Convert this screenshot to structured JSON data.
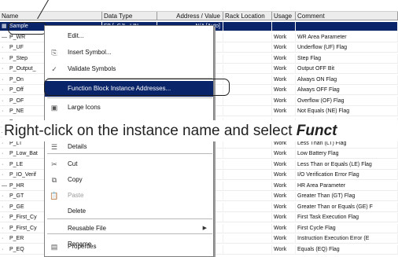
{
  "table": {
    "columns": [
      "Name",
      "Data Type",
      "Address / Value",
      "Rack Location",
      "Usage",
      "Comment"
    ],
    "rows": [
      {
        "marker": "▦",
        "name": "Sample",
        "type": "FB [_CJL_LIN",
        "addr": "N/A [Auto]",
        "rack": "",
        "usage": "",
        "comment": "",
        "selected": true
      },
      {
        "marker": "—",
        "name": "P_WR",
        "type": "",
        "addr": "",
        "rack": "",
        "usage": "Work",
        "comment": "WR Area Parameter"
      },
      {
        "marker": "·",
        "name": "P_UF",
        "type": "",
        "addr": "",
        "rack": "",
        "usage": "Work",
        "comment": "Underflow (UF) Flag"
      },
      {
        "marker": "·",
        "name": "P_Step",
        "type": "",
        "addr": "",
        "rack": "",
        "usage": "Work",
        "comment": "Step Flag"
      },
      {
        "marker": "·",
        "name": "P_Output_",
        "type": "",
        "addr": "",
        "rack": "",
        "usage": "Work",
        "comment": "Output OFF Bit"
      },
      {
        "marker": "·",
        "name": "P_On",
        "type": "",
        "addr": "",
        "rack": "",
        "usage": "Work",
        "comment": "Always ON Flag"
      },
      {
        "marker": "·",
        "name": "P_Off",
        "type": "",
        "addr": "",
        "rack": "",
        "usage": "Work",
        "comment": "Always OFF Flag"
      },
      {
        "marker": "·",
        "name": "P_OF",
        "type": "",
        "addr": "",
        "rack": "",
        "usage": "Work",
        "comment": "Overflow (OF) Flag"
      },
      {
        "marker": "·",
        "name": "P_NE",
        "type": "",
        "addr": "",
        "rack": "",
        "usage": "Work",
        "comment": "Not Equals (NE) Flag"
      },
      {
        "marker": "·",
        "name": "P_",
        "type": "",
        "addr": "",
        "rack": "",
        "usage": "",
        "comment": ""
      },
      {
        "marker": "—",
        "name": "F",
        "type": "",
        "addr": "",
        "rack": "",
        "usage": "",
        "comment": ""
      },
      {
        "marker": "·",
        "name": "P_LT",
        "type": "",
        "addr": "",
        "rack": "",
        "usage": "Work",
        "comment": "Less Than (LT) Flag"
      },
      {
        "marker": "·",
        "name": "P_Low_Bat",
        "type": "",
        "addr": "",
        "rack": "",
        "usage": "Work",
        "comment": "Low Battery Flag"
      },
      {
        "marker": "·",
        "name": "P_LE",
        "type": "",
        "addr": "",
        "rack": "",
        "usage": "Work",
        "comment": "Less Than or Equals (LE) Flag"
      },
      {
        "marker": "·",
        "name": "P_IO_Verif",
        "type": "",
        "addr": "",
        "rack": "",
        "usage": "Work",
        "comment": "I/O Verification Error Flag"
      },
      {
        "marker": "—",
        "name": "P_HR",
        "type": "",
        "addr": "",
        "rack": "",
        "usage": "Work",
        "comment": "HR Area Parameter"
      },
      {
        "marker": "·",
        "name": "P_GT",
        "type": "",
        "addr": "",
        "rack": "",
        "usage": "Work",
        "comment": "Greater Than (GT) Flag"
      },
      {
        "marker": "·",
        "name": "P_GE",
        "type": "",
        "addr": "",
        "rack": "",
        "usage": "Work",
        "comment": "Greater Than or Equals (GE) F"
      },
      {
        "marker": "·",
        "name": "P_First_Cy",
        "type": "",
        "addr": "",
        "rack": "",
        "usage": "Work",
        "comment": "First Task Execution Flag"
      },
      {
        "marker": "·",
        "name": "P_First_Cy",
        "type": "",
        "addr": "",
        "rack": "",
        "usage": "Work",
        "comment": "First Cycle Flag"
      },
      {
        "marker": "·",
        "name": "P_ER",
        "type": "",
        "addr": "",
        "rack": "",
        "usage": "Work",
        "comment": "Instruction Execution Error (E"
      },
      {
        "marker": "·",
        "name": "P_EQ",
        "type": "",
        "addr": "",
        "rack": "",
        "usage": "Work",
        "comment": "Equals (EQ) Flag"
      }
    ]
  },
  "context_menu": {
    "items": [
      {
        "id": "edit",
        "label": "Edit...",
        "icon": "",
        "icon_name": "none",
        "state": "normal"
      },
      {
        "id": "insert-symbol",
        "label": "Insert Symbol...",
        "icon": "⎘",
        "icon_name": "insert-symbol-icon",
        "state": "normal"
      },
      {
        "id": "validate-symbols",
        "label": "Validate Symbols",
        "icon": "✓",
        "icon_name": "validate-symbols-icon",
        "state": "normal"
      },
      {
        "id": "fb-instance-addresses",
        "label": "Function Block Instance Addresses...",
        "icon": "",
        "icon_name": "none",
        "state": "highlighted"
      },
      {
        "id": "large-icons",
        "label": "Large Icons",
        "icon": "▣",
        "icon_name": "large-icons-icon",
        "state": "normal"
      },
      {
        "id": "small-icons",
        "label": "",
        "icon": "▪",
        "icon_name": "small-icons-icon",
        "state": "normal"
      },
      {
        "id": "list",
        "label": "",
        "icon": "",
        "icon_name": "none",
        "state": "normal"
      },
      {
        "id": "details",
        "label": "Details",
        "icon": "☰",
        "icon_name": "details-icon",
        "state": "normal"
      },
      {
        "id": "cut",
        "label": "Cut",
        "icon": "✂",
        "icon_name": "cut-icon",
        "state": "normal"
      },
      {
        "id": "copy",
        "label": "Copy",
        "icon": "⧉",
        "icon_name": "copy-icon",
        "state": "normal"
      },
      {
        "id": "paste",
        "label": "Paste",
        "icon": "📋",
        "icon_name": "paste-icon",
        "state": "disabled"
      },
      {
        "id": "delete",
        "label": "Delete",
        "icon": "",
        "icon_name": "none",
        "state": "normal"
      },
      {
        "id": "reusable-file",
        "label": "Reusable File",
        "icon": "",
        "icon_name": "none",
        "state": "normal",
        "submenu": "▶"
      },
      {
        "id": "rename",
        "label": "Rename",
        "icon": "",
        "icon_name": "none",
        "state": "normal"
      },
      {
        "id": "properties",
        "label": "Properties",
        "icon": "▤",
        "icon_name": "properties-icon",
        "state": "normal"
      }
    ]
  },
  "caption": {
    "text": "Right-click on the instance name and select ",
    "emphasis": "Funct"
  },
  "colors": {
    "selection": "#0a246a",
    "header_bg": "#ececec",
    "menu_bg": "#ffffff"
  }
}
